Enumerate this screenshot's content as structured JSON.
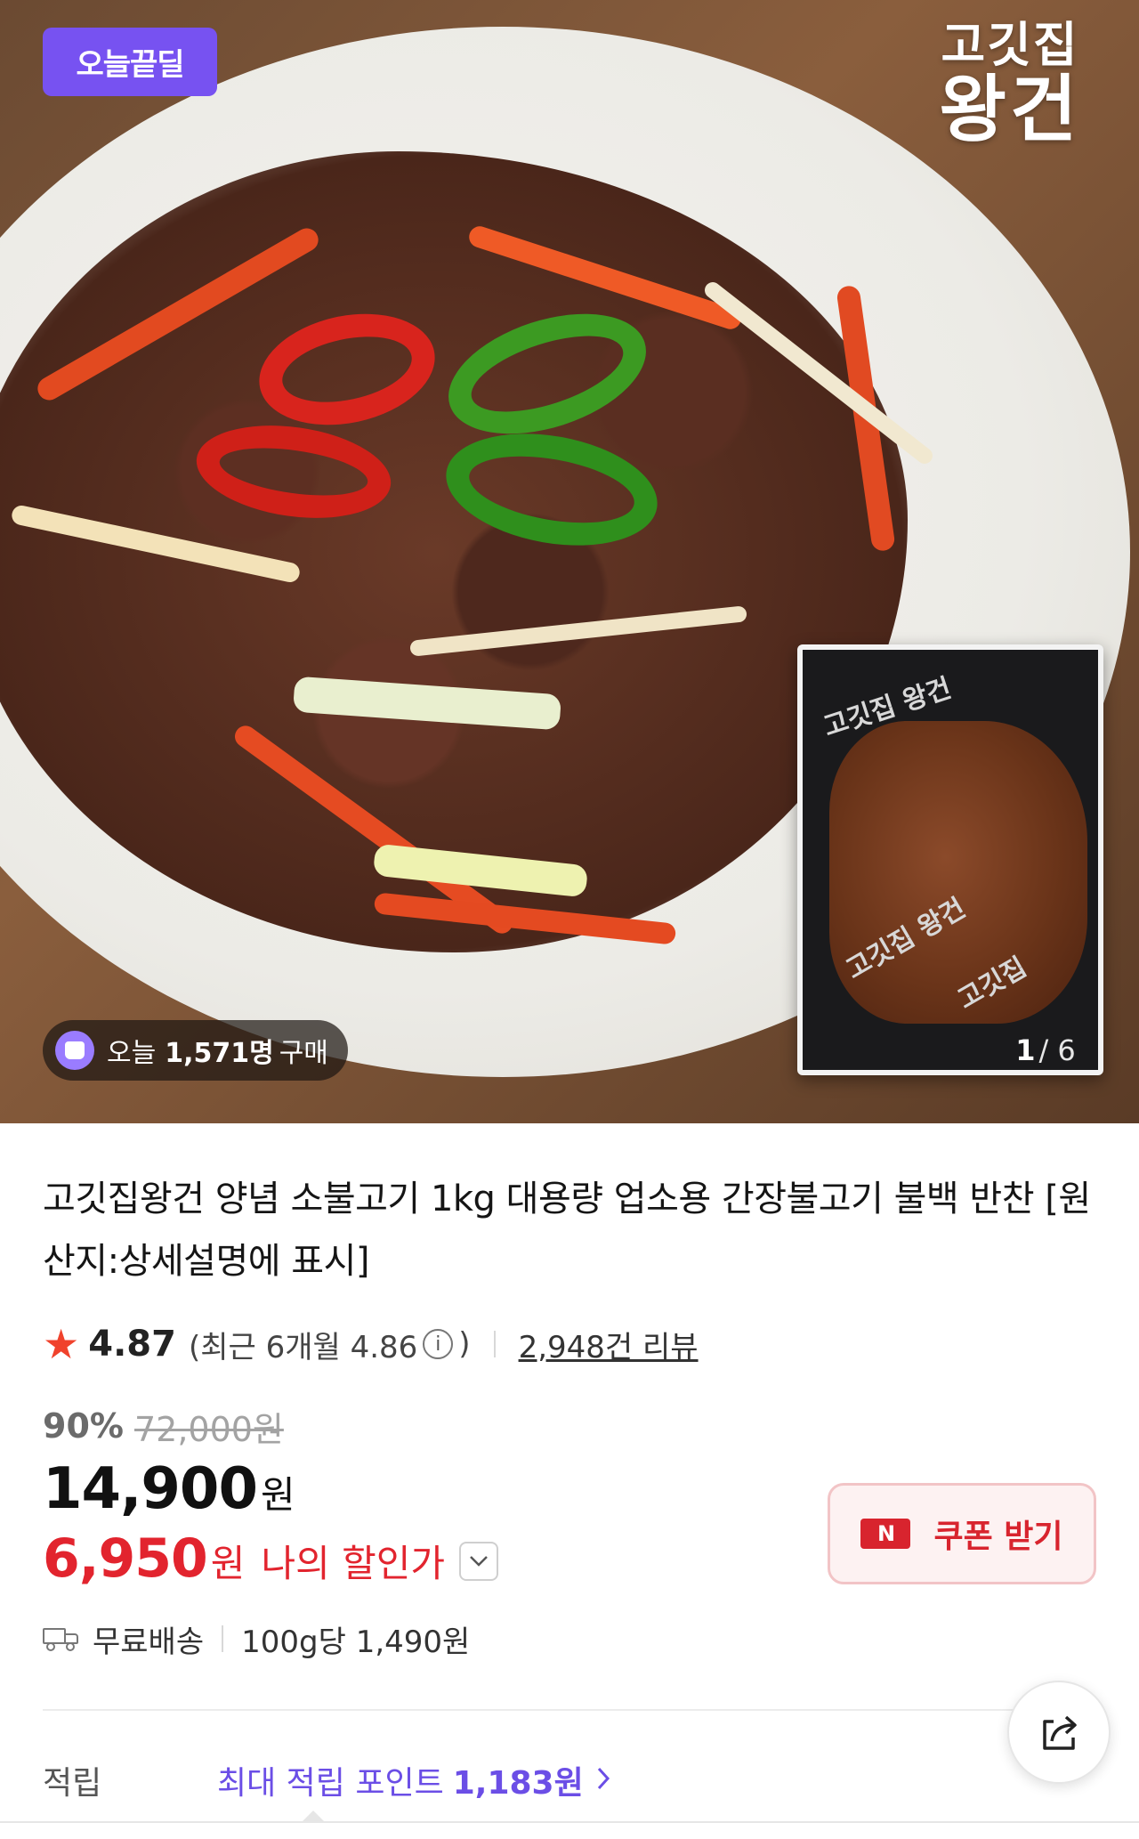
{
  "hero": {
    "deal_badge": "오늘끝딜",
    "brand_logo_line1": "고깃집",
    "brand_logo_line2": "왕건",
    "package_text_1": "고깃집 왕건",
    "package_text_2": "고깃집 왕건",
    "package_text_3": "고깃집",
    "image_index": "1",
    "image_total": "/ 6",
    "purchase_prefix": "오늘",
    "purchase_count": "1,571명",
    "purchase_suffix": "구매"
  },
  "product": {
    "title": "고깃집왕건 양념 소불고기 1kg 대용량 업소용 간장불고기 불백 반찬 [원산지:상세설명에 표시]",
    "rating": "4.87",
    "recent_rating_text": "(최근 6개월 4.86",
    "recent_rating_close": ")",
    "review_count": "2,948건 리뷰"
  },
  "price": {
    "discount_percent": "90%",
    "original_price": "72,000원",
    "sale_price": "14,900",
    "won": "원",
    "my_price": "6,950",
    "my_price_won": "원",
    "my_price_label": "나의 할인가"
  },
  "coupon": {
    "logo": "N",
    "label": "쿠폰 받기"
  },
  "shipping": {
    "label": "무료배송",
    "unit_price": "100g당 1,490원"
  },
  "points": {
    "label": "적립",
    "prefix": "최대 적립 포인트",
    "value": "1,183원"
  },
  "colors": {
    "accent_purple": "#7752f1",
    "discount_red": "#e2242e",
    "points_purple": "#6b4ee6"
  },
  "icons": [
    "star-icon",
    "info-icon",
    "chevron-down-icon",
    "truck-icon",
    "share-icon",
    "chevron-right-icon",
    "shopping-bag-icon"
  ]
}
